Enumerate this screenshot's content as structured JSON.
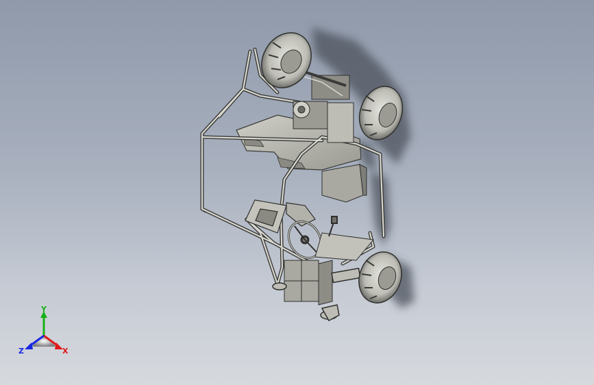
{
  "viewport": {
    "background_top": "#8f99aa",
    "background_bottom": "#d6d9de"
  },
  "model": {
    "frame_color": "#c8c8c0",
    "frame_stroke": "#3a3a38",
    "panel_color": "#b9b9b2",
    "tire_color": "#bdbdb6",
    "shadow_color": "#5a5f68"
  },
  "triad": {
    "x_label": "X",
    "y_label": "Y",
    "z_label": "Z",
    "x_color": "#e01818",
    "y_color": "#18b018",
    "z_color": "#1828e0"
  }
}
